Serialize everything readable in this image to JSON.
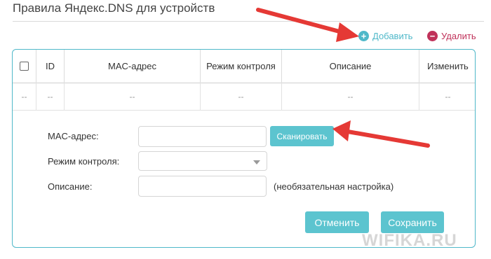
{
  "page": {
    "title": "Правила Яндекс.DNS для устройств"
  },
  "toolbar": {
    "add_label": "Добавить",
    "add_icon": "+",
    "delete_label": "Удалить",
    "delete_icon": "−"
  },
  "table": {
    "columns": [
      "ID",
      "MAC-адрес",
      "Режим контроля",
      "Описание",
      "Изменить"
    ],
    "rows": [
      [
        "--",
        "--",
        "--",
        "--",
        "--",
        "--"
      ]
    ]
  },
  "form": {
    "mac_label": "MAC-адрес:",
    "mac_value": "",
    "scan_label": "Сканировать",
    "mode_label": "Режим контроля:",
    "mode_value": "",
    "desc_label": "Описание:",
    "desc_value": "",
    "desc_hint": "(необязательная настройка)",
    "cancel_label": "Отменить",
    "save_label": "Сохранить"
  },
  "watermark": "WIFIKA.RU",
  "colors": {
    "accent": "#5cc4cf",
    "delete": "#c0325a",
    "annotation_arrow": "#e53935"
  }
}
